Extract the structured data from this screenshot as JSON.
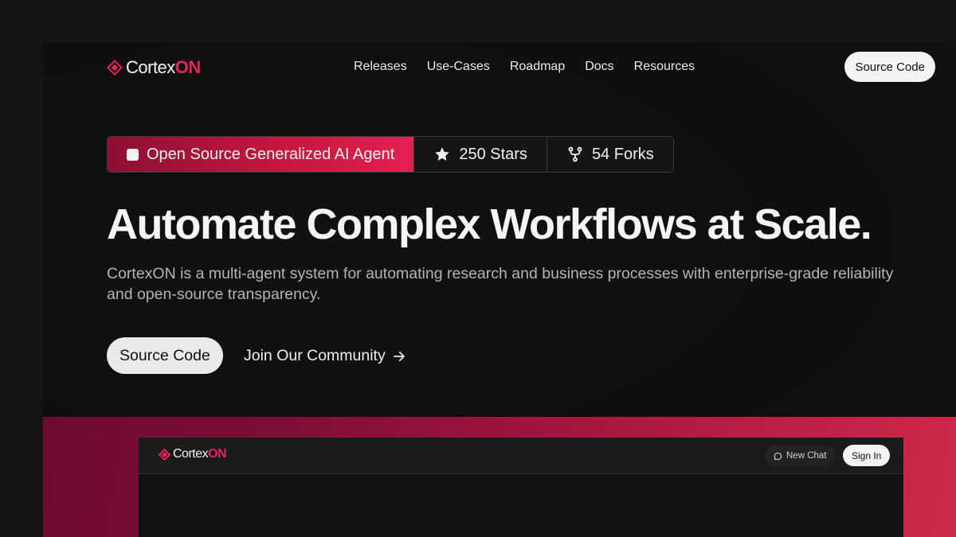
{
  "brand": {
    "name_main": "Cortex",
    "name_accent": "ON",
    "accent_color": "#e8245a"
  },
  "nav": {
    "links": [
      "Releases",
      "Use-Cases",
      "Roadmap",
      "Docs",
      "Resources"
    ],
    "cta_label": "Source Code"
  },
  "badges": {
    "primary_label": "Open Source Generalized AI Agent",
    "stars_label": "250 Stars",
    "forks_label": "54 Forks"
  },
  "hero": {
    "headline": "Automate Complex Workflows at Scale.",
    "subtext": "CortexON is a multi-agent system for automating research and business processes with enterprise-grade reliability and open-source transparency.",
    "primary_cta": "Source Code",
    "secondary_cta": "Join Our Community"
  },
  "preview": {
    "new_chat_label": "New Chat",
    "sign_in_label": "Sign In"
  },
  "icons": {
    "logo": "cortexon-diamond-icon",
    "badge_primary": "square-icon",
    "stars": "star-icon",
    "forks": "fork-icon",
    "arrow": "arrow-right-icon",
    "chat": "chat-bubble-icon"
  },
  "colors": {
    "background": "#141414",
    "primary_gradient_start": "#8c1034",
    "primary_gradient_end": "#e52052",
    "band_gradient_start": "#6e0b33",
    "band_gradient_end": "#cf2a4b"
  }
}
